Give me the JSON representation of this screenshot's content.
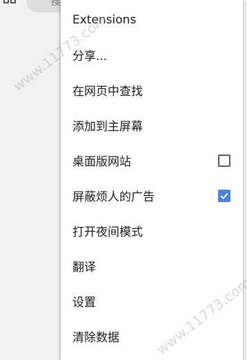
{
  "background": {
    "tab_fragment": "搜"
  },
  "menu": {
    "items": [
      {
        "label": "Extensions",
        "checkbox": null
      },
      {
        "label": "分享...",
        "checkbox": null
      },
      {
        "label": "在网页中查找",
        "checkbox": null
      },
      {
        "label": "添加到主屏幕",
        "checkbox": null
      },
      {
        "label": "桌面版网站",
        "checkbox": "unchecked"
      },
      {
        "label": "屏蔽烦人的广告",
        "checkbox": "checked"
      },
      {
        "label": "打开夜间模式",
        "checkbox": null
      },
      {
        "label": "翻译",
        "checkbox": null
      },
      {
        "label": "设置",
        "checkbox": null
      },
      {
        "label": "清除数据",
        "checkbox": null
      }
    ]
  },
  "watermark": {
    "text": "www.11773.com"
  },
  "colors": {
    "checkbox_checked": "#4a80e0",
    "checkbox_unchecked_border": "#5f5f5f",
    "menu_background": "#ffffff",
    "text": "#212121"
  }
}
